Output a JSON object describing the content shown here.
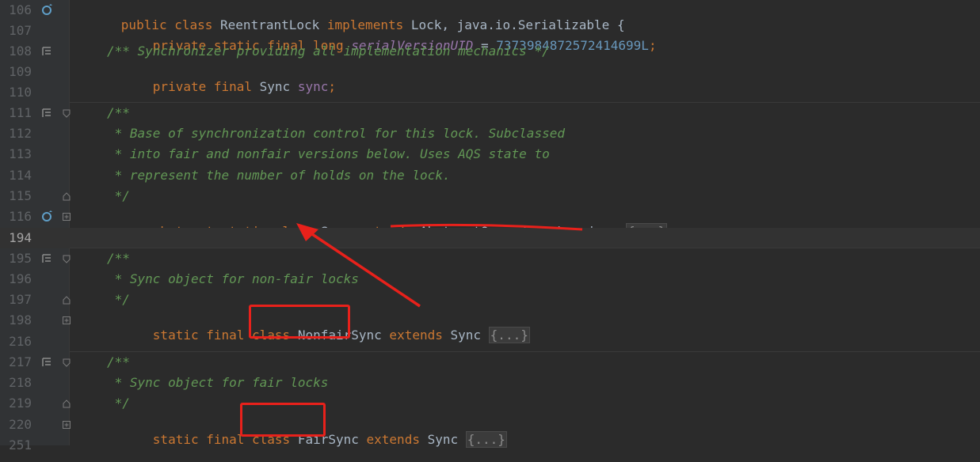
{
  "editor": {
    "lines": {
      "l106": {
        "num": "106",
        "parts": [
          "public class ",
          "ReentrantLock ",
          "implements ",
          "Lock, java.io.Serializable {"
        ]
      },
      "l107": {
        "num": "107",
        "parts": [
          "private static final long ",
          "serialVersionUID",
          " = ",
          "7373984872572414699L",
          ";"
        ]
      },
      "l108": {
        "num": "108",
        "text": "/** Synchronizer providing all implementation mechanics */"
      },
      "l109": {
        "num": "109",
        "parts": [
          "private final ",
          "Sync ",
          "sync",
          ";"
        ]
      },
      "l110": {
        "num": "110"
      },
      "l111": {
        "num": "111",
        "text": "/**"
      },
      "l112": {
        "num": "112",
        "text": " * Base of synchronization control for this lock. Subclassed"
      },
      "l113": {
        "num": "113",
        "text": " * into fair and nonfair versions below. Uses AQS state to"
      },
      "l114": {
        "num": "114",
        "text": " * represent the number of holds on the lock."
      },
      "l115": {
        "num": "115",
        "text": " */"
      },
      "l116": {
        "num": "116",
        "parts": [
          "abstract static class ",
          "Sync ",
          "extends ",
          "AbstractQueuedSynchronizer",
          " "
        ],
        "fold": "{...}"
      },
      "l194": {
        "num": "194"
      },
      "l195": {
        "num": "195",
        "text": "/**"
      },
      "l196": {
        "num": "196",
        "text": " * Sync object for non-fair locks"
      },
      "l197": {
        "num": "197",
        "text": " */"
      },
      "l198": {
        "num": "198",
        "parts": [
          "static final class ",
          "NonfairSync",
          " extends ",
          "Sync "
        ],
        "fold": "{...}"
      },
      "l216": {
        "num": "216"
      },
      "l217": {
        "num": "217",
        "text": "/**"
      },
      "l218": {
        "num": "218",
        "text": " * Sync object for fair locks"
      },
      "l219": {
        "num": "219",
        "text": " */"
      },
      "l220": {
        "num": "220",
        "parts": [
          "static final class ",
          "FairSync",
          " extends ",
          "Sync "
        ],
        "fold": "{...}"
      },
      "l251": {
        "num": "251"
      }
    }
  },
  "colors": {
    "background": "#2b2b2b",
    "keyword": "#cc7832",
    "comment": "#629755",
    "number": "#6897bb",
    "annotation": "#e8211b"
  }
}
